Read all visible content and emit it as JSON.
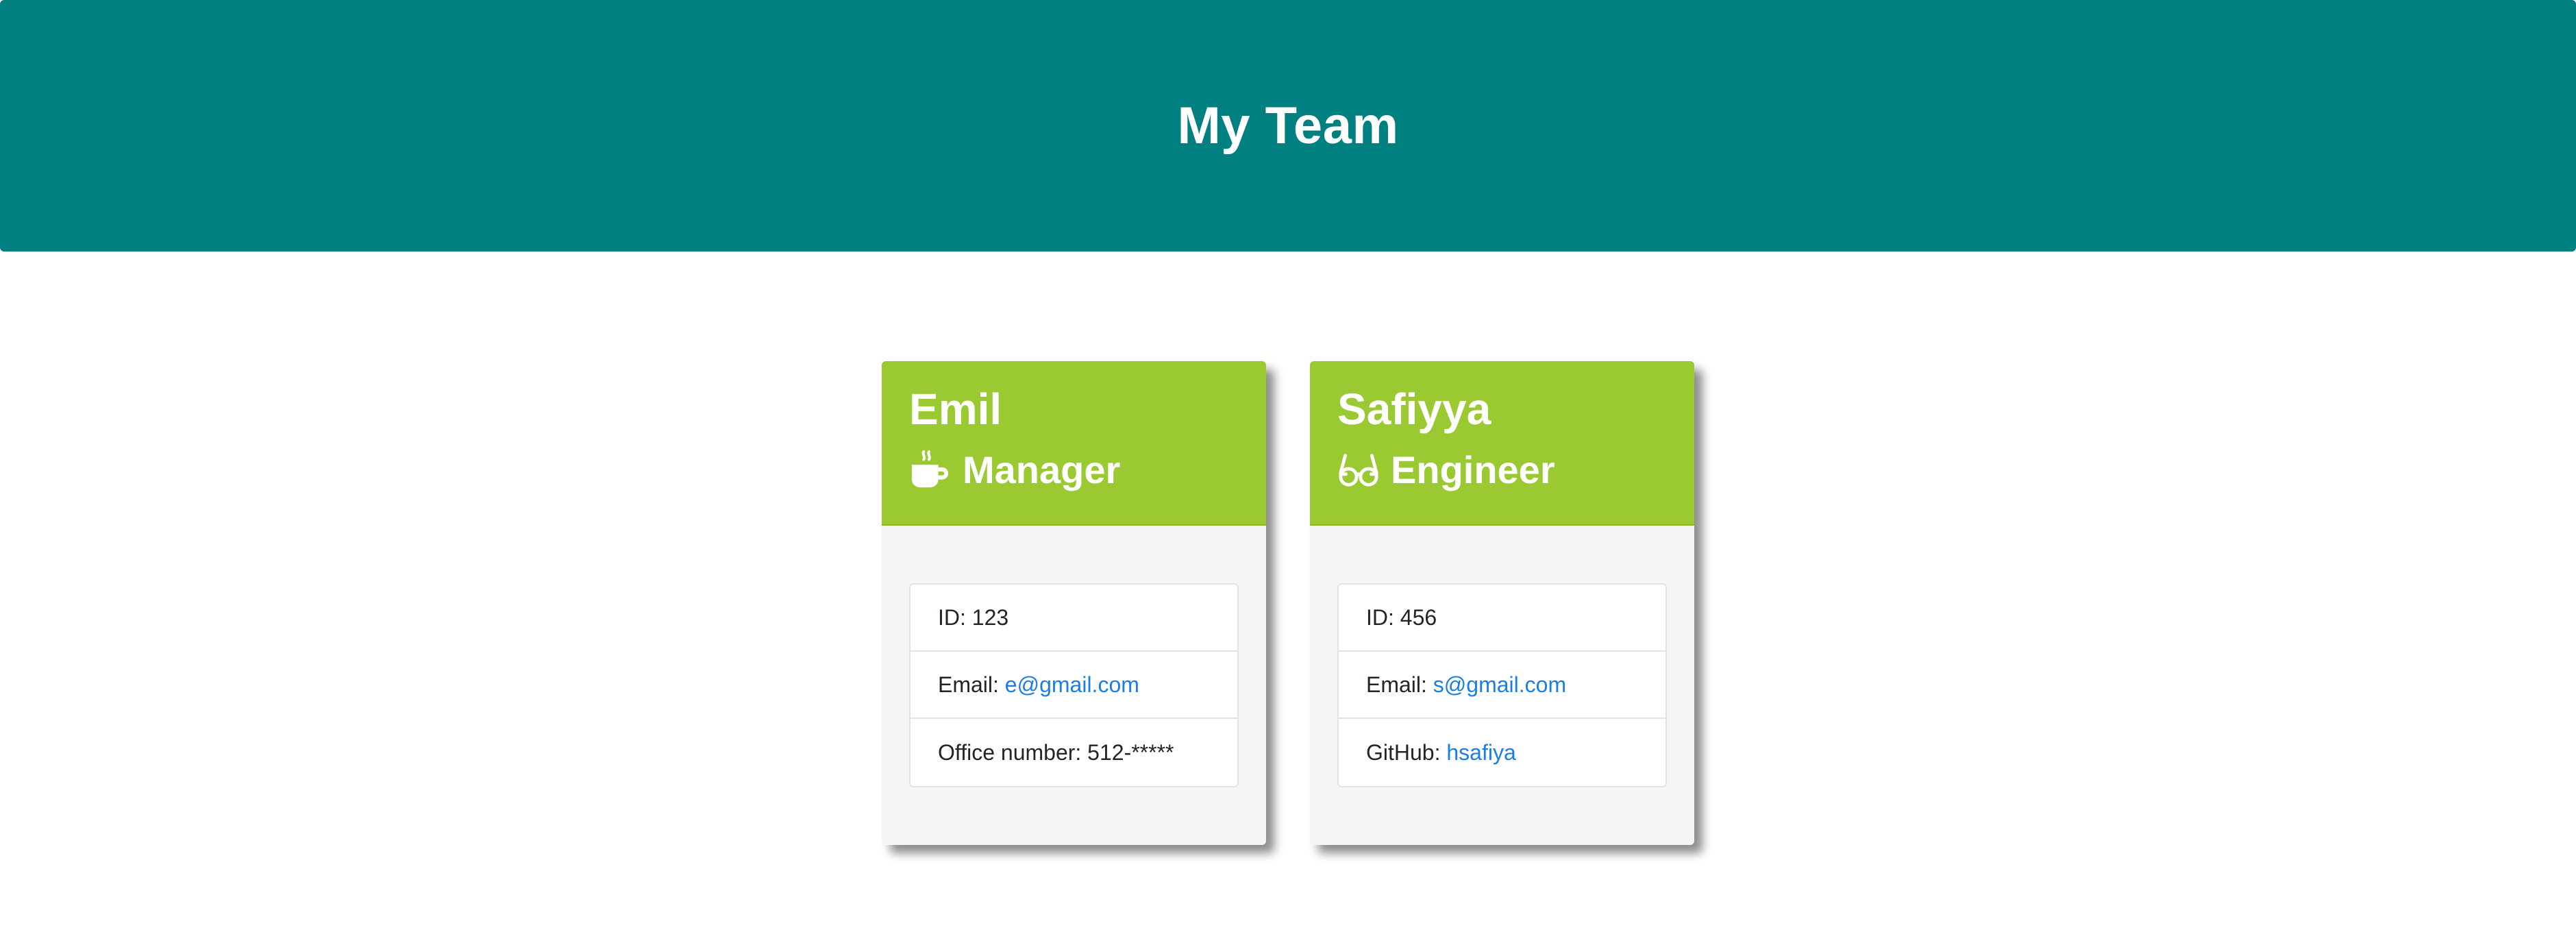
{
  "header": {
    "title": "My Team"
  },
  "colors": {
    "header_bg": "#008080",
    "card_header_bg": "#9ac931",
    "link": "#1a7ee6"
  },
  "cards": [
    {
      "name": "Emil",
      "role": "Manager",
      "role_icon": "mug-hot-icon",
      "items": [
        {
          "label": "ID: ",
          "value": "123"
        },
        {
          "label": "Email: ",
          "value": "e@gmail.com"
        },
        {
          "label": "Office number: ",
          "value": "512-*****"
        }
      ]
    },
    {
      "name": "Safiyya",
      "role": "Engineer",
      "role_icon": "glasses-icon",
      "items": [
        {
          "label": "ID: ",
          "value": "456"
        },
        {
          "label": "Email: ",
          "value": "s@gmail.com"
        },
        {
          "label": "GitHub: ",
          "value": "hsafiya"
        }
      ]
    }
  ]
}
